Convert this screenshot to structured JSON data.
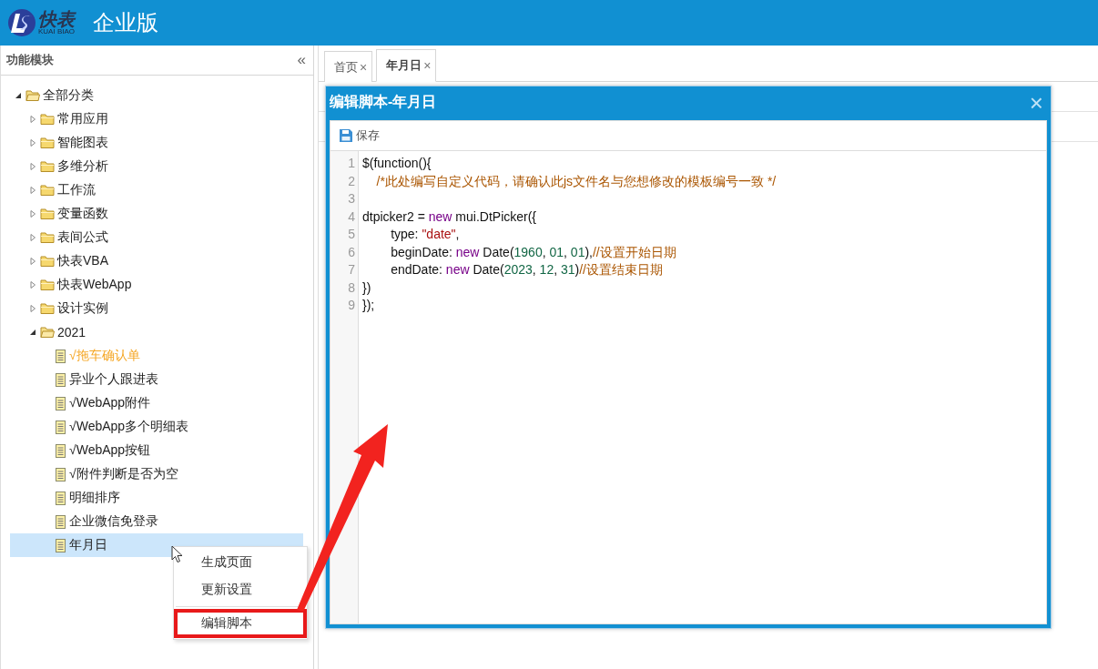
{
  "header": {
    "logo_text": "快表",
    "logo_subtext": "KUAI BIAO",
    "title": "企业版"
  },
  "sidebar": {
    "title": "功能模块",
    "collapse": "«",
    "tree": [
      {
        "label": "全部分类",
        "kind": "folder",
        "expanded": true,
        "selected": false,
        "highlighted": false,
        "children": [
          {
            "label": "常用应用",
            "kind": "folder",
            "expanded": false,
            "selected": false,
            "highlighted": false
          },
          {
            "label": "智能图表",
            "kind": "folder",
            "expanded": false,
            "selected": false,
            "highlighted": false
          },
          {
            "label": "多维分析",
            "kind": "folder",
            "expanded": false,
            "selected": false,
            "highlighted": false
          },
          {
            "label": "工作流",
            "kind": "folder",
            "expanded": false,
            "selected": false,
            "highlighted": false
          },
          {
            "label": "变量函数",
            "kind": "folder",
            "expanded": false,
            "selected": false,
            "highlighted": false
          },
          {
            "label": "表间公式",
            "kind": "folder",
            "expanded": false,
            "selected": false,
            "highlighted": false
          },
          {
            "label": "快表VBA",
            "kind": "folder",
            "expanded": false,
            "selected": false,
            "highlighted": false
          },
          {
            "label": "快表WebApp",
            "kind": "folder",
            "expanded": false,
            "selected": false,
            "highlighted": false
          },
          {
            "label": "设计实例",
            "kind": "folder",
            "expanded": false,
            "selected": false,
            "highlighted": false
          },
          {
            "label": "2021",
            "kind": "folder",
            "expanded": true,
            "selected": false,
            "highlighted": false,
            "children": [
              {
                "label": "√拖车确认单",
                "kind": "file",
                "selected": false,
                "highlighted": true
              },
              {
                "label": "异业个人跟进表",
                "kind": "file",
                "selected": false,
                "highlighted": false
              },
              {
                "label": "√WebApp附件",
                "kind": "file",
                "selected": false,
                "highlighted": false
              },
              {
                "label": "√WebApp多个明细表",
                "kind": "file",
                "selected": false,
                "highlighted": false
              },
              {
                "label": "√WebApp按钮",
                "kind": "file",
                "selected": false,
                "highlighted": false
              },
              {
                "label": "√附件判断是否为空",
                "kind": "file",
                "selected": false,
                "highlighted": false
              },
              {
                "label": "明细排序",
                "kind": "file",
                "selected": false,
                "highlighted": false
              },
              {
                "label": "企业微信免登录",
                "kind": "file",
                "selected": false,
                "highlighted": false
              },
              {
                "label": "年月日",
                "kind": "file",
                "selected": true,
                "highlighted": false
              }
            ]
          }
        ]
      }
    ]
  },
  "tabs": [
    {
      "label": "首页",
      "close": "×",
      "selected": false
    },
    {
      "label": "年月日",
      "close": "×",
      "selected": true
    }
  ],
  "dialog": {
    "title": "编辑脚本-年月日",
    "close": "×",
    "save_label": "保存",
    "code_lines": [
      {
        "number": "1",
        "tokens": [
          {
            "kind": "plain",
            "text": "$(function(){"
          }
        ]
      },
      {
        "number": "2",
        "tokens": [
          {
            "kind": "comment",
            "text": "    /*此处编写自定义代码，请确认此js文件名与您想修改的模板编号一致 */"
          }
        ]
      },
      {
        "number": "3"
      },
      {
        "number": "4",
        "tokens": [
          {
            "kind": "plain",
            "text": "dtpicker2 = "
          },
          {
            "kind": "keyword",
            "text": "new"
          },
          {
            "kind": "plain",
            "text": " mui.DtPicker({"
          }
        ]
      },
      {
        "number": "5",
        "tokens": [
          {
            "kind": "plain",
            "text": "\ttype: "
          },
          {
            "kind": "string",
            "text": "\"date\""
          },
          {
            "kind": "plain",
            "text": ","
          }
        ]
      },
      {
        "number": "6",
        "tokens": [
          {
            "kind": "plain",
            "text": "\tbeginDate: "
          },
          {
            "kind": "keyword",
            "text": "new"
          },
          {
            "kind": "plain",
            "text": " Date("
          },
          {
            "kind": "number",
            "text": "1960"
          },
          {
            "kind": "plain",
            "text": ", "
          },
          {
            "kind": "number",
            "text": "01"
          },
          {
            "kind": "plain",
            "text": ", "
          },
          {
            "kind": "number",
            "text": "01"
          },
          {
            "kind": "plain",
            "text": "),"
          },
          {
            "kind": "comment",
            "text": "//设置开始日期"
          }
        ]
      },
      {
        "number": "7",
        "tokens": [
          {
            "kind": "plain",
            "text": "\tendDate: "
          },
          {
            "kind": "keyword",
            "text": "new"
          },
          {
            "kind": "plain",
            "text": " Date("
          },
          {
            "kind": "number",
            "text": "2023"
          },
          {
            "kind": "plain",
            "text": ", "
          },
          {
            "kind": "number",
            "text": "12"
          },
          {
            "kind": "plain",
            "text": ", "
          },
          {
            "kind": "number",
            "text": "31"
          },
          {
            "kind": "plain",
            "text": ")"
          },
          {
            "kind": "comment",
            "text": "//设置结束日期"
          }
        ]
      },
      {
        "number": "8",
        "tokens": [
          {
            "kind": "plain",
            "text": "})"
          }
        ]
      },
      {
        "number": "9",
        "tokens": [
          {
            "kind": "plain",
            "text": "});"
          }
        ]
      }
    ]
  },
  "context_menu": [
    {
      "label": "生成页面",
      "annotated": false
    },
    {
      "label": "更新设置",
      "annotated": false
    },
    {
      "label": "编辑脚本",
      "annotated": true
    }
  ]
}
